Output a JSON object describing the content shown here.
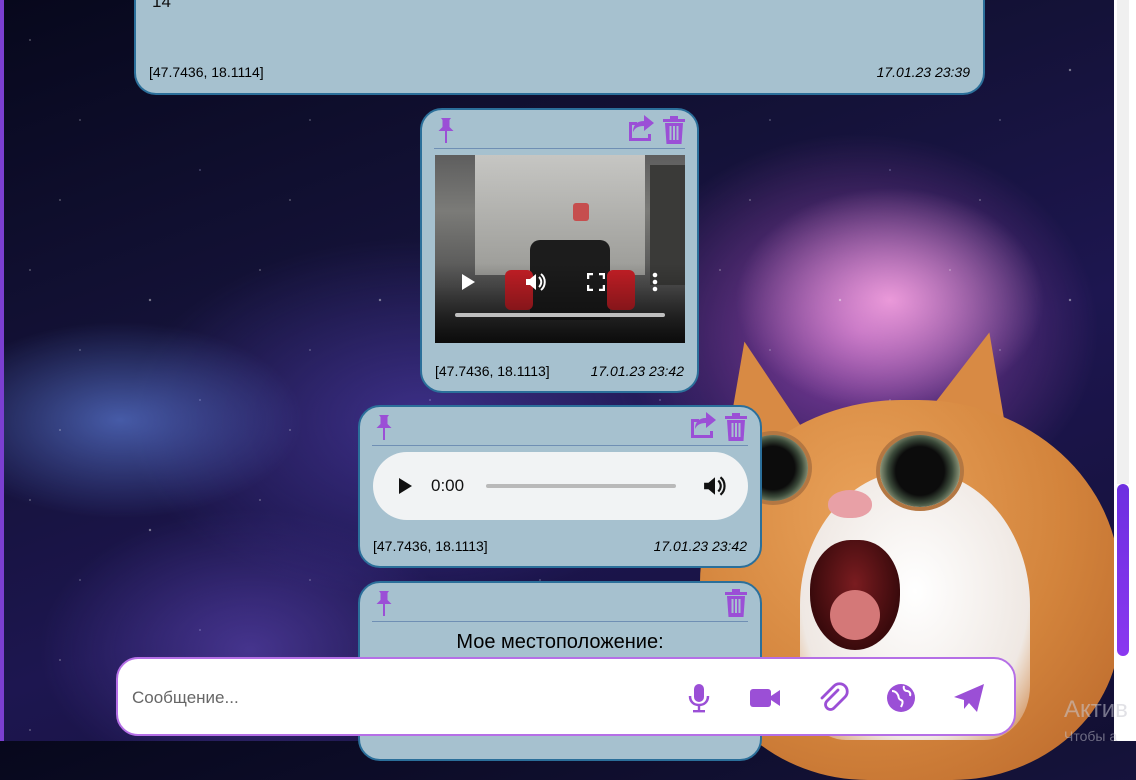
{
  "colors": {
    "accent": "#9b4fd6",
    "bubble_bg": "#a6c1cf",
    "bubble_border": "#2b6f9a"
  },
  "messages": [
    {
      "type": "text",
      "text": "14",
      "geo": "[47.7436, 18.1114]",
      "time": "17.01.23 23:39"
    },
    {
      "type": "video",
      "geo": "[47.7436, 18.1113]",
      "time": "17.01.23 23:42",
      "icons": [
        "pin-icon",
        "share-icon",
        "trash-icon"
      ]
    },
    {
      "type": "audio",
      "player_time": "0:00",
      "geo": "[47.7436, 18.1113]",
      "time": "17.01.23 23:42",
      "icons": [
        "pin-icon",
        "share-icon",
        "trash-icon"
      ]
    },
    {
      "type": "location",
      "title": "Мое местоположение:",
      "icons": [
        "pin-icon",
        "trash-icon"
      ]
    }
  ],
  "composer": {
    "placeholder": "Сообщение...",
    "buttons": [
      "microphone-icon",
      "video-camera-icon",
      "paperclip-icon",
      "globe-icon",
      "send-icon"
    ]
  },
  "watermark": {
    "line1": "Актив",
    "line2": "Чтобы а"
  }
}
